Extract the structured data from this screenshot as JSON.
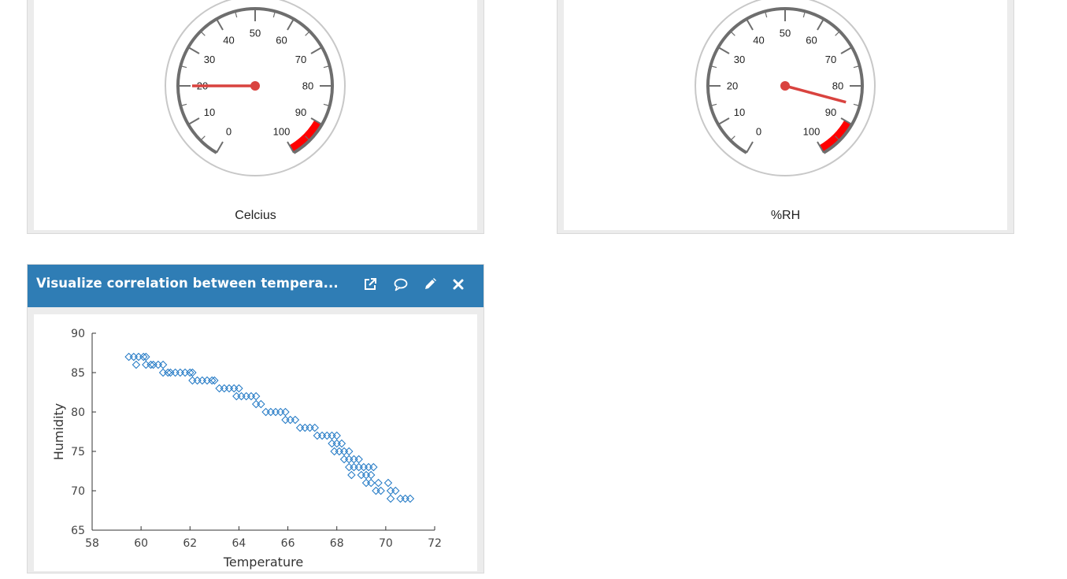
{
  "temperature_widget": {
    "label": "Celcius",
    "needle_value": 20,
    "min": 0,
    "max": 100,
    "tick_labels": [
      "0",
      "10",
      "20",
      "30",
      "40",
      "50",
      "60",
      "70",
      "80",
      "90",
      "100"
    ],
    "red_band": [
      90,
      100
    ],
    "colors": {
      "arc": "#6e6e6e",
      "needle": "#d9433f",
      "band": "#ff0000",
      "ring": "#c8c8c8"
    }
  },
  "humidity_widget": {
    "label": "%RH",
    "needle_value": 85,
    "min": 0,
    "max": 100,
    "tick_labels": [
      "0",
      "10",
      "20",
      "30",
      "40",
      "50",
      "60",
      "70",
      "80",
      "90",
      "100"
    ],
    "red_band": [
      90,
      100
    ],
    "colors": {
      "arc": "#6e6e6e",
      "needle": "#d9433f",
      "band": "#ff0000",
      "ring": "#c8c8c8"
    }
  },
  "scatter_widget": {
    "title": "Visualize correlation between tempera...",
    "toolbar": {
      "open_icon": "external-link-icon",
      "comment_icon": "comment-icon",
      "edit_icon": "pencil-icon",
      "close_icon": "close-icon"
    },
    "header_color": "#2f7db5",
    "chart_data": {
      "type": "scatter",
      "title": "",
      "xlabel": "Temperature",
      "ylabel": "Humidity",
      "xlim": [
        58,
        72
      ],
      "ylim": [
        65,
        90
      ],
      "xticks": [
        "58",
        "60",
        "62",
        "64",
        "66",
        "68",
        "70",
        "72"
      ],
      "yticks": [
        "65",
        "70",
        "75",
        "80",
        "85",
        "90"
      ],
      "marker_color": "#1f77c4",
      "marker": "diamond",
      "points": [
        [
          59.5,
          87
        ],
        [
          59.7,
          87
        ],
        [
          59.9,
          87
        ],
        [
          60.1,
          87
        ],
        [
          60.2,
          87
        ],
        [
          59.8,
          86
        ],
        [
          60.2,
          86
        ],
        [
          60.4,
          86
        ],
        [
          60.5,
          86
        ],
        [
          60.7,
          86
        ],
        [
          60.9,
          86
        ],
        [
          60.9,
          85
        ],
        [
          61.1,
          85
        ],
        [
          61.2,
          85
        ],
        [
          61.4,
          85
        ],
        [
          61.6,
          85
        ],
        [
          61.8,
          85
        ],
        [
          62.0,
          85
        ],
        [
          62.1,
          85
        ],
        [
          62.1,
          84
        ],
        [
          62.3,
          84
        ],
        [
          62.5,
          84
        ],
        [
          62.7,
          84
        ],
        [
          62.9,
          84
        ],
        [
          63.0,
          84
        ],
        [
          63.2,
          83
        ],
        [
          63.4,
          83
        ],
        [
          63.6,
          83
        ],
        [
          63.8,
          83
        ],
        [
          64.0,
          83
        ],
        [
          63.9,
          82
        ],
        [
          64.1,
          82
        ],
        [
          64.3,
          82
        ],
        [
          64.5,
          82
        ],
        [
          64.7,
          82
        ],
        [
          64.7,
          81
        ],
        [
          64.9,
          81
        ],
        [
          65.1,
          80
        ],
        [
          65.3,
          80
        ],
        [
          65.5,
          80
        ],
        [
          65.7,
          80
        ],
        [
          65.9,
          80
        ],
        [
          65.9,
          79
        ],
        [
          66.1,
          79
        ],
        [
          66.3,
          79
        ],
        [
          66.5,
          78
        ],
        [
          66.7,
          78
        ],
        [
          66.9,
          78
        ],
        [
          67.1,
          78
        ],
        [
          67.2,
          77
        ],
        [
          67.4,
          77
        ],
        [
          67.6,
          77
        ],
        [
          67.8,
          77
        ],
        [
          68.0,
          77
        ],
        [
          67.8,
          76
        ],
        [
          68.0,
          76
        ],
        [
          68.2,
          76
        ],
        [
          67.9,
          75
        ],
        [
          68.1,
          75
        ],
        [
          68.3,
          75
        ],
        [
          68.5,
          75
        ],
        [
          68.3,
          74
        ],
        [
          68.5,
          74
        ],
        [
          68.7,
          74
        ],
        [
          68.9,
          74
        ],
        [
          68.5,
          73
        ],
        [
          68.7,
          73
        ],
        [
          68.9,
          73
        ],
        [
          69.1,
          73
        ],
        [
          69.3,
          73
        ],
        [
          69.5,
          73
        ],
        [
          68.6,
          72
        ],
        [
          69.0,
          72
        ],
        [
          69.2,
          72
        ],
        [
          69.4,
          72
        ],
        [
          69.2,
          71
        ],
        [
          69.4,
          71
        ],
        [
          69.7,
          71
        ],
        [
          70.1,
          71
        ],
        [
          69.6,
          70
        ],
        [
          69.8,
          70
        ],
        [
          70.2,
          70
        ],
        [
          70.4,
          70
        ],
        [
          70.2,
          69
        ],
        [
          70.6,
          69
        ],
        [
          70.8,
          69
        ],
        [
          71.0,
          69
        ]
      ]
    }
  }
}
